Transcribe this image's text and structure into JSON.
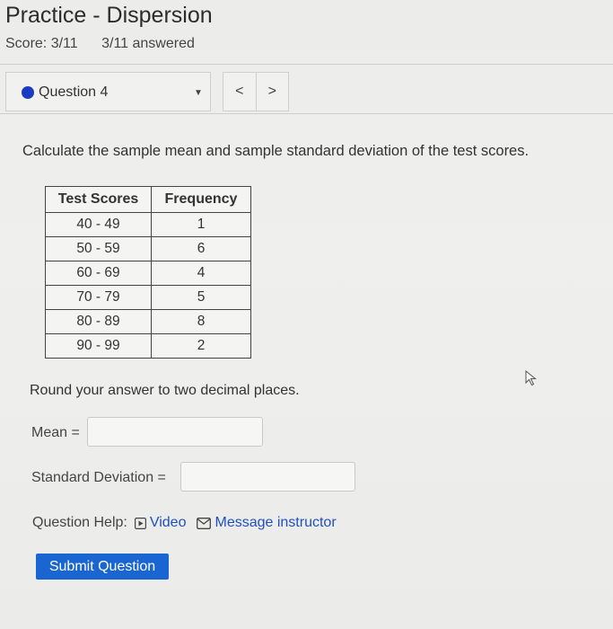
{
  "header": {
    "title": "Practice - Dispersion",
    "score": "Score: 3/11",
    "answered": "3/11 answered"
  },
  "question_nav": {
    "label": "Question 4",
    "prev": "<",
    "next": ">",
    "colors": {
      "dot": "#1a3cc0"
    }
  },
  "question": {
    "text": "Calculate the sample mean and sample standard deviation of the test scores.",
    "table": {
      "headers": [
        "Test Scores",
        "Frequency"
      ],
      "rows": [
        [
          "40 - 49",
          "1"
        ],
        [
          "50 - 59",
          "6"
        ],
        [
          "60 - 69",
          "4"
        ],
        [
          "70 - 79",
          "5"
        ],
        [
          "80 - 89",
          "8"
        ],
        [
          "90 - 99",
          "2"
        ]
      ]
    },
    "instruction": "Round your answer to two decimal places.",
    "mean_label": "Mean =",
    "mean_value": "",
    "sd_label": "Standard Deviation =",
    "sd_value": ""
  },
  "help": {
    "label": "Question Help:",
    "video": "Video",
    "message": "Message instructor"
  },
  "submit_label": "Submit Question",
  "colors": {
    "accent": "#1966d2",
    "link": "#1f4fc0"
  }
}
